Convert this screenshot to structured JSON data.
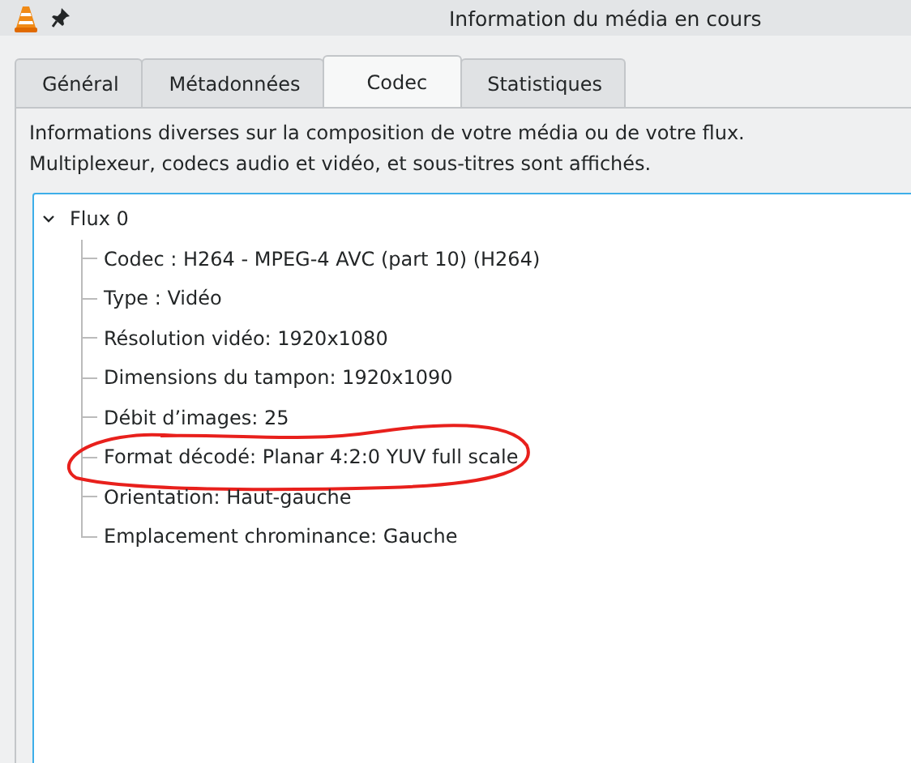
{
  "window": {
    "title": "Information du média en cours",
    "pinned": false
  },
  "tabs": [
    {
      "label": "Général",
      "selected": false
    },
    {
      "label": "Métadonnées",
      "selected": false
    },
    {
      "label": "Codec",
      "selected": true
    },
    {
      "label": "Statistiques",
      "selected": false
    }
  ],
  "description": [
    "Informations diverses sur la composition de votre média ou de votre flux.",
    "Multiplexeur, codecs audio et vidéo, et sous-titres sont affichés."
  ],
  "tree": [
    {
      "label": "Flux 0",
      "expanded": true,
      "children": [
        {
          "label": "Codec : H264 - MPEG-4 AVC (part 10) (H264)",
          "circled": false
        },
        {
          "label": "Type : Vidéo",
          "circled": false
        },
        {
          "label": "Résolution vidéo: 1920x1080",
          "circled": false
        },
        {
          "label": "Dimensions du tampon: 1920x1090",
          "circled": false
        },
        {
          "label": "Débit d’images: 25",
          "circled": false
        },
        {
          "label": "Format décodé: Planar 4:2:0 YUV full scale",
          "circled": true
        },
        {
          "label": "Orientation: Haut-gauche",
          "circled": false
        },
        {
          "label": "Emplacement chrominance: Gauche",
          "circled": false
        }
      ]
    }
  ]
}
